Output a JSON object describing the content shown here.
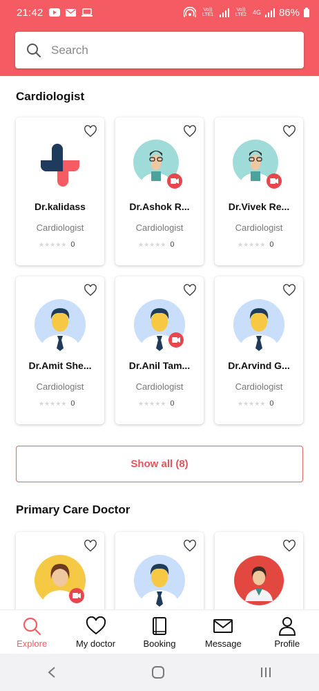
{
  "status_bar": {
    "time": "21:42",
    "network_1": "Vo)) LTE1",
    "network_2": "Vo)) LTE2",
    "network_type": "4G",
    "battery": "86%"
  },
  "search": {
    "placeholder": "Search"
  },
  "sections": [
    {
      "title": "Cardiologist",
      "cards": [
        {
          "name": "Dr.kalidass",
          "specialty": "Cardiologist",
          "rating": "0",
          "avatar": "logo-cross-icon",
          "video": false
        },
        {
          "name": "Dr.Ashok R...",
          "specialty": "Cardiologist",
          "rating": "0",
          "avatar": "doctor-glasses-avatar",
          "video": true
        },
        {
          "name": "Dr.Vivek Re...",
          "specialty": "Cardiologist",
          "rating": "0",
          "avatar": "doctor-glasses-avatar",
          "video": true
        },
        {
          "name": "Dr.Amit She...",
          "specialty": "Cardiologist",
          "rating": "0",
          "avatar": "doctor-male-avatar",
          "video": false
        },
        {
          "name": "Dr.Anil Tam...",
          "specialty": "Cardiologist",
          "rating": "0",
          "avatar": "doctor-male-avatar",
          "video": true
        },
        {
          "name": "Dr.Arvind G...",
          "specialty": "Cardiologist",
          "rating": "0",
          "avatar": "doctor-male-avatar",
          "video": false
        }
      ],
      "show_all_label": "Show all (8)"
    },
    {
      "title": "Primary Care Doctor",
      "cards": [
        {
          "avatar": "doctor-female-avatar",
          "video": true
        },
        {
          "avatar": "doctor-male-avatar",
          "video": false
        },
        {
          "avatar": "doctor-female-red-avatar",
          "video": false
        }
      ]
    }
  ],
  "bottom_nav": [
    {
      "label": "Explore",
      "icon": "search-icon",
      "active": true
    },
    {
      "label": "My doctor",
      "icon": "heart-icon",
      "active": false
    },
    {
      "label": "Booking",
      "icon": "book-icon",
      "active": false
    },
    {
      "label": "Message",
      "icon": "envelope-icon",
      "active": false
    },
    {
      "label": "Profile",
      "icon": "user-icon",
      "active": false
    }
  ],
  "colors": {
    "accent": "#f45b62",
    "logo_navy": "#1e3a5c",
    "video_badge": "#e8454c"
  }
}
